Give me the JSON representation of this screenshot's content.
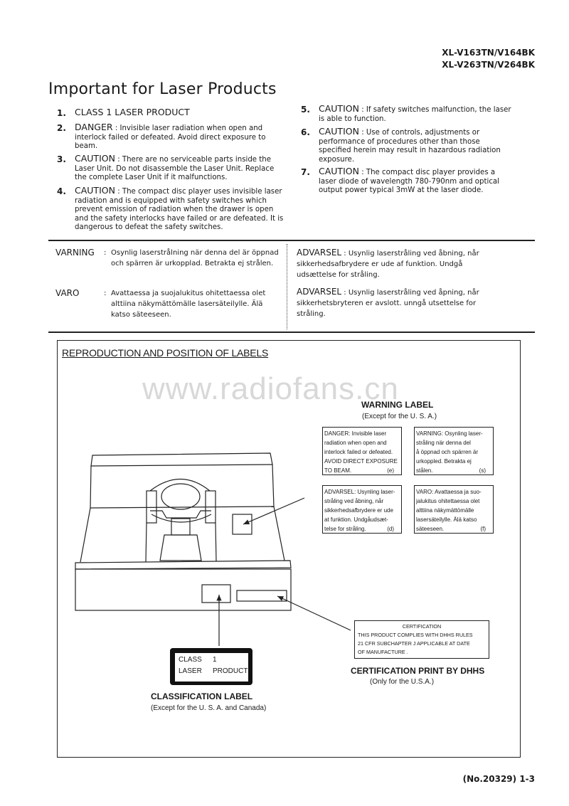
{
  "header": {
    "models": [
      "XL-V163TN/V164BK",
      "XL-V263TN/V264BK"
    ]
  },
  "title": "Important for Laser Products",
  "items_left": [
    {
      "num": "1.",
      "key": "CLASS 1 LASER PRODUCT",
      "text": ""
    },
    {
      "num": "2.",
      "key": "DANGER",
      "text": "Invisible laser radiation when open and interlock failed or defeated. Avoid direct exposure to beam."
    },
    {
      "num": "3.",
      "key": "CAUTION",
      "text": "There are no serviceable parts inside the Laser Unit. Do not disassemble the Laser Unit. Replace the complete Laser Unit if it malfunctions."
    },
    {
      "num": "4.",
      "key": "CAUTION",
      "text": "The compact disc player uses invisible laser radiation and is equipped with safety switches which prevent emission of radiation when the drawer is open and the safety interlocks have failed or are defeated. It is dangerous to defeat the safety switches."
    }
  ],
  "items_right": [
    {
      "num": "5.",
      "key": "CAUTION",
      "text": "If safety switches malfunction, the laser is able to function."
    },
    {
      "num": "6.",
      "key": "CAUTION",
      "text": "Use of controls, adjustments or performance of procedures other than those specified herein may result in hazardous radiation exposure."
    },
    {
      "num": "7.",
      "key": "CAUTION",
      "text": "The compact disc player provides a laser diode of wavelength 780-790nm and optical output power typical 3mW at the laser diode."
    }
  ],
  "separator": " : ",
  "foreign_left": [
    {
      "key": "VARNING",
      "text": "Osynlig laserstrålning när denna del är öppnad och spärren är urkopplad. Betrakta ej strålen."
    },
    {
      "key": "VARO",
      "text": "Avattaessa ja suojalukitus ohitettaessa olet alttiina näkymättömälle lasersäteilylle. Älä katso säteeseen."
    }
  ],
  "foreign_right": [
    {
      "key": "ADVARSEL",
      "text": "Usynlig laserstråling ved åbning, når sikkerhedsafbrydere er ude af funktion. Undgå udsættelse for stråling."
    },
    {
      "key": "ADVARSEL",
      "text": "Usynlig laserstråling ved åpning, når sikkerhetsbryteren er avslott. unngå utsettelse for stråling."
    }
  ],
  "labels_section": {
    "title": "REPRODUCTION AND POSITION OF LABELS",
    "watermark": "www.radiofans.cn",
    "warning_label": {
      "title": "WARNING LABEL",
      "subtitle": "(Except for the U. S. A.)",
      "boxes": [
        {
          "lines": [
            "DANGER:   Invisible laser",
            "radiation when open and",
            "interlock failed or defeated.",
            "AVOID DIRECT EXPOSURE",
            "TO BEAM."
          ],
          "tag": "(e)"
        },
        {
          "lines": [
            "VARNING:   Osynling laser-",
            "stråling när denna del",
            "å öppnad och spärren är",
            "urkoppled.   Betrakta ej",
            "stålen."
          ],
          "tag": "(s)"
        },
        {
          "lines": [
            "ADVARSEL:  Usynling laser-",
            "stråling ved åbning,  når",
            "sikkerhedsafbrydere er ude",
            "at funktion.  Undgåudsæt-",
            "telse for stråling."
          ],
          "tag": "(d)"
        },
        {
          "lines": [
            "VARO:      Avattaessa ja suo-",
            "jalukitus ohitettaessa olet",
            "alttiina  näkymättömälle",
            "lasersäteilylle.  Älä  katso",
            "säteeseen."
          ],
          "tag": "(f)"
        }
      ]
    },
    "certification": {
      "box_lines": [
        "CERTIFICATION",
        "THIS PRODUCT COMPLIES WITH DHHS RULES",
        "21 CFR SUBCHAPTER J APPLICABLE AT DATE",
        "OF MANUFACTURE ."
      ],
      "title": "CERTIFICATION PRINT BY DHHS",
      "subtitle": "(Only for the U.S.A.)"
    },
    "classification": {
      "label_row1": [
        "CLASS",
        "1"
      ],
      "label_row2": [
        "LASER",
        "PRODUCT"
      ],
      "title": "CLASSIFICATION  LABEL",
      "subtitle": "(Except for the U. S. A. and Canada)"
    }
  },
  "footer": {
    "page_number": "(No.20329) 1-3"
  }
}
